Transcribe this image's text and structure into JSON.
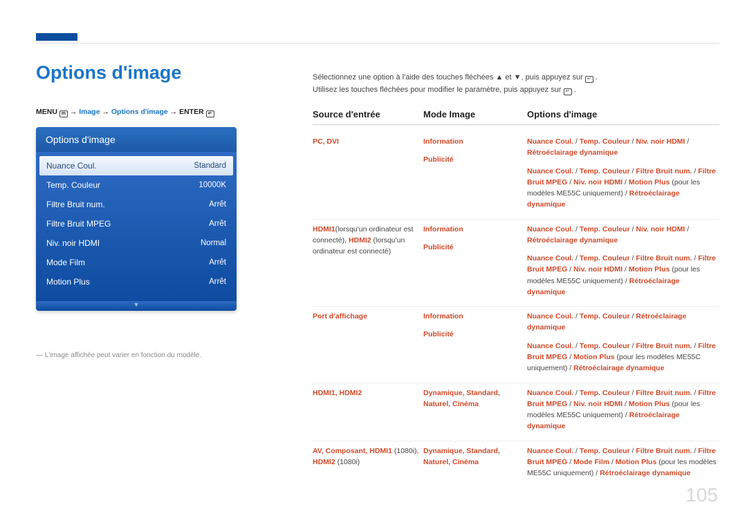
{
  "title": "Options d'image",
  "breadcrumb": {
    "menu": "MENU",
    "seg1": "Image",
    "seg2": "Options d'image",
    "enter": "ENTER"
  },
  "osd": {
    "title": "Options d'image",
    "items": [
      {
        "label": "Nuance Coul.",
        "value": "Standard"
      },
      {
        "label": "Temp. Couleur",
        "value": "10000K"
      },
      {
        "label": "Filtre Bruit num.",
        "value": "Arrêt"
      },
      {
        "label": "Filtre Bruit MPEG",
        "value": "Arrêt"
      },
      {
        "label": "Niv. noir HDMI",
        "value": "Normal"
      },
      {
        "label": "Mode Film",
        "value": "Arrêt"
      },
      {
        "label": "Motion Plus",
        "value": "Arrêt"
      }
    ]
  },
  "note": "― L'image affichée peut varier en fonction du modèle.",
  "desc": {
    "line1a": "Sélectionnez une option à l'aide des touches fléchées ▲ et ▼, puis appuyez sur ",
    "line1b": ".",
    "line2a": "Utilisez les touches fléchées pour modifier le paramètre, puis appuyez sur ",
    "line2b": "."
  },
  "table": {
    "headers": {
      "source": "Source d'entrée",
      "mode": "Mode Image",
      "options": "Options d'image"
    },
    "rows": [
      {
        "source_red": "PC, DVI",
        "source_plain": "",
        "sub": [
          {
            "mode_red": "Information",
            "opt_html": "r:Nuance Coul.| / |r:Temp. Couleur| / |r:Niv. noir HDMI| / |r:Rétroéclairage dynamique"
          },
          {
            "mode_red": "Publicité",
            "opt_html": "r:Nuance Coul.| / |r:Temp. Couleur| / |r:Filtre Bruit num.| / |r:Filtre Bruit MPEG| / |r:Niv. noir HDMI| / |r:Motion Plus| (pour les modèles ME55C uniquement) / |r:Rétroéclairage dynamique"
          }
        ]
      },
      {
        "source_red": "HDMI1",
        "source_plain": "(lorsqu'un ordinateur est connecté), ",
        "source_red2": "HDMI2",
        "source_plain2": " (lorsqu'un ordinateur est connecté)",
        "sub": [
          {
            "mode_red": "Information",
            "opt_html": "r:Nuance Coul.| / |r:Temp. Couleur| / |r:Niv. noir HDMI| / |r:Rétroéclairage dynamique"
          },
          {
            "mode_red": "Publicité",
            "opt_html": "r:Nuance Coul.| / |r:Temp. Couleur| / |r:Filtre Bruit num.| / |r:Filtre Bruit MPEG| / |r:Niv. noir HDMI| / |r:Motion Plus| (pour les modèles ME55C uniquement) / |r:Rétroéclairage dynamique"
          }
        ]
      },
      {
        "source_red": "Port d'affichage",
        "source_plain": "",
        "sub": [
          {
            "mode_red": "Information",
            "opt_html": "r:Nuance Coul.| / |r:Temp. Couleur| / |r:Rétroéclairage dynamique"
          },
          {
            "mode_red": "Publicité",
            "opt_html": "r:Nuance Coul.| / |r:Temp. Couleur| / |r:Filtre Bruit num.| / |r:Filtre Bruit MPEG| / |r:Motion Plus| (pour les modèles ME55C uniquement) / |r:Rétroéclairage dynamique"
          }
        ]
      },
      {
        "source_red": "HDMI1, HDMI2",
        "source_plain": "",
        "sub": [
          {
            "mode_red": "Dynamique, Standard, Naturel, Cinéma",
            "opt_html": "r:Nuance Coul.| / |r:Temp. Couleur| / |r:Filtre Bruit num.| / |r:Filtre Bruit MPEG| / |r:Niv. noir HDMI| / |r:Motion Plus| (pour les modèles ME55C uniquement) / |r:Rétroéclairage dynamique"
          }
        ]
      },
      {
        "source_red": "AV, Composant, HDMI1",
        "source_plain": " (1080i), ",
        "source_red2": "HDMI2",
        "source_plain2": " (1080i)",
        "sub": [
          {
            "mode_red": "Dynamique, Standard, Naturel, Cinéma",
            "opt_html": "r:Nuance Coul.| / |r:Temp. Couleur| / |r:Filtre Bruit num.| / |r:Filtre Bruit MPEG| / |r:Mode Film| / |r:Motion Plus| (pour les modèles ME55C uniquement) / |r:Rétroéclairage dynamique"
          }
        ]
      }
    ]
  },
  "page": "105"
}
